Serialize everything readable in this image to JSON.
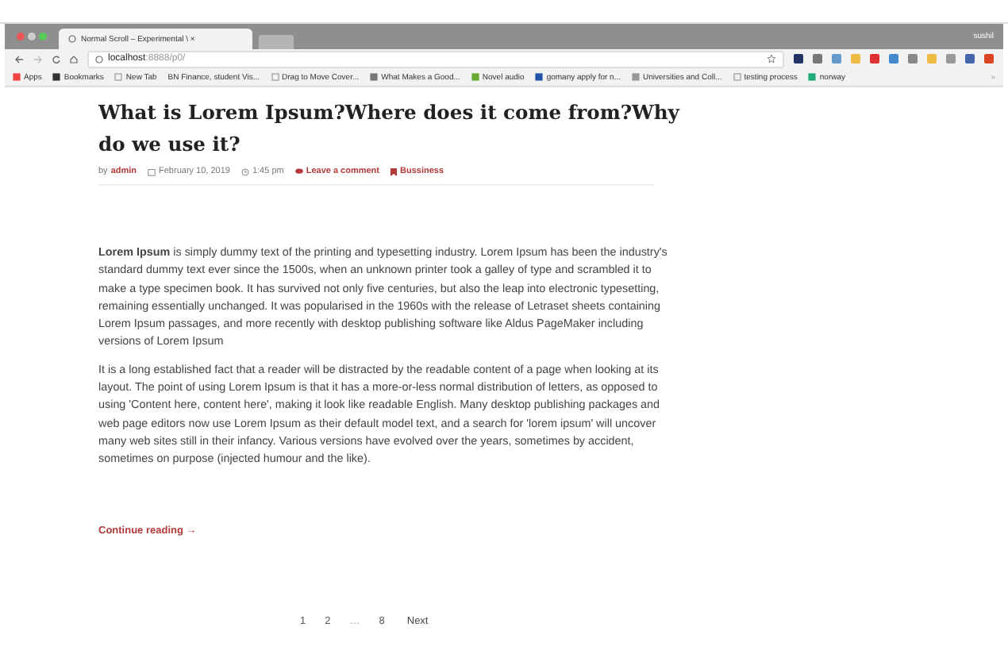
{
  "browser": {
    "tab": {
      "title": "Normal Scroll – Experimental \\ ×"
    },
    "profile": "sushil",
    "address": {
      "host": "localhost",
      "path": ":8888/p0/"
    },
    "bookmarks": [
      {
        "label": "Apps",
        "kind": "apps"
      },
      {
        "label": "Bookmarks",
        "kind": "star"
      },
      {
        "label": "New Tab",
        "kind": "page"
      },
      {
        "label": "BN Finance, student Vis...",
        "kind": "text"
      },
      {
        "label": "Drag to Move Cover...",
        "kind": "page"
      },
      {
        "label": "What Makes a Good...",
        "kind": "pin"
      },
      {
        "label": "Novel audio",
        "kind": "green"
      },
      {
        "label": "gomany apply for n...",
        "kind": "blue"
      },
      {
        "label": "Universities and Coll...",
        "kind": "bar"
      },
      {
        "label": "testing process",
        "kind": "page"
      },
      {
        "label": "norway",
        "kind": "arrow"
      }
    ],
    "bookmarks_more": "»"
  },
  "post": {
    "title": "What is Lorem Ipsum?Where does it come from?Why do we use it?",
    "meta": {
      "by": "by",
      "author": "admin",
      "date": "February 10, 2019",
      "time": "1:45 pm",
      "comments": "Leave a comment",
      "category": "Bussiness"
    },
    "paragraphs": [
      "**Lorem Ipsum** is simply dummy text of the printing and typesetting industry. Lorem Ipsum has been the industry's standard dummy text ever since the 1500s, when an unknown printer took a galley of type and scrambled it to make a type specimen book. It has survived not only five centuries, but also the leap into electronic typesetting, remaining essentially unchanged. It was popularised in the 1960s with the release of Letraset sheets containing Lorem Ipsum passages, and more recently with desktop publishing software like Aldus PageMaker including versions of Lorem Ipsum",
      "It is a long established fact that a reader will be distracted by the readable content of a page when looking at its layout. The point of using Lorem Ipsum is that it has a more-or-less normal distribution of letters, as opposed to using 'Content here, content here', making it look like readable English. Many desktop publishing packages and web page editors now use Lorem Ipsum as their default model text, and a search for 'lorem ipsum' will uncover many web sites still in their infancy. Various versions have evolved over the years, sometimes by accident, sometimes on purpose (injected humour and the like)."
    ],
    "continue": "Continue reading →"
  },
  "pagination": [
    {
      "label": "1",
      "kind": "page"
    },
    {
      "label": "2",
      "kind": "page"
    },
    {
      "label": "…",
      "kind": "gap"
    },
    {
      "label": "8",
      "kind": "page"
    },
    {
      "label": "Next",
      "kind": "next"
    }
  ]
}
